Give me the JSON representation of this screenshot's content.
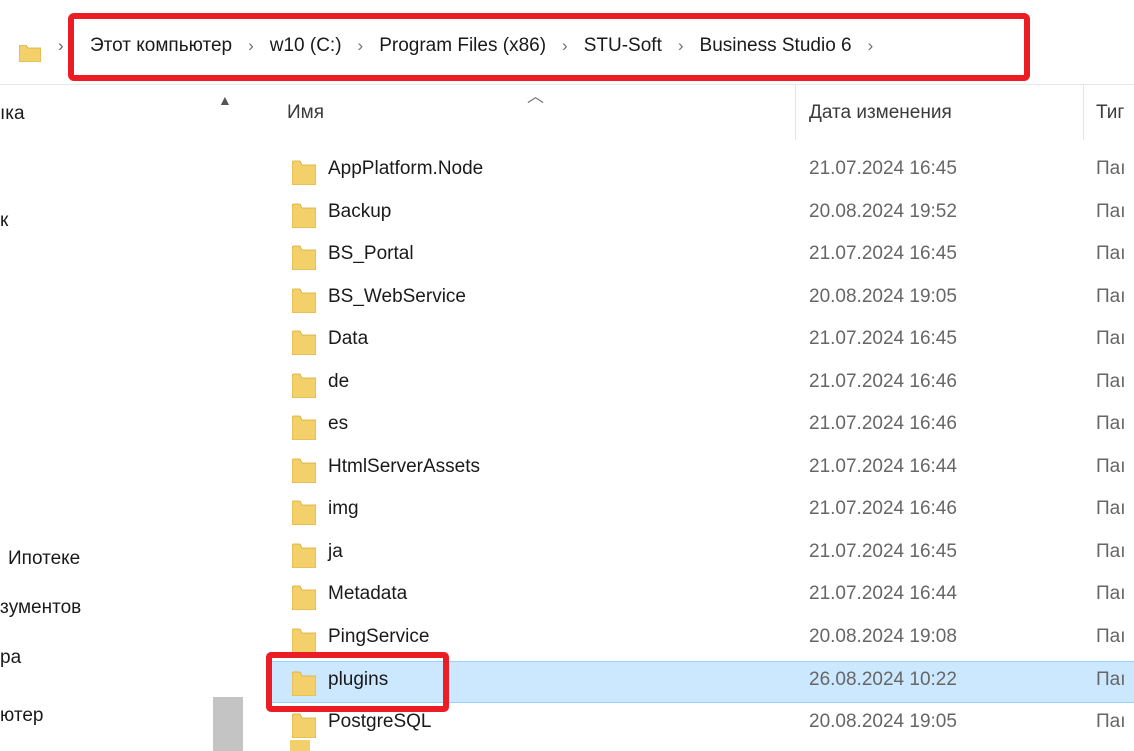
{
  "address_bar": {
    "crumbs": [
      "Этот компьютер",
      "w10 (C:)",
      "Program Files (x86)",
      "STU-Soft",
      "Business Studio 6"
    ],
    "separator": "›"
  },
  "nav_pane": {
    "items": [
      "ıка",
      "к",
      "Ипотеке",
      "ɜументов",
      "ра",
      "ютер"
    ]
  },
  "columns": {
    "name": "Имя",
    "date": "Дата изменения",
    "type": "Тиг"
  },
  "files": [
    {
      "name": "AppPlatform.Node",
      "date": "21.07.2024 16:45",
      "type": "Паı"
    },
    {
      "name": "Backup",
      "date": "20.08.2024 19:52",
      "type": "Паı"
    },
    {
      "name": "BS_Portal",
      "date": "21.07.2024 16:45",
      "type": "Паı"
    },
    {
      "name": "BS_WebService",
      "date": "20.08.2024 19:05",
      "type": "Паı"
    },
    {
      "name": "Data",
      "date": "21.07.2024 16:45",
      "type": "Паı"
    },
    {
      "name": "de",
      "date": "21.07.2024 16:46",
      "type": "Паı"
    },
    {
      "name": "es",
      "date": "21.07.2024 16:46",
      "type": "Паı"
    },
    {
      "name": "HtmlServerAssets",
      "date": "21.07.2024 16:44",
      "type": "Паı"
    },
    {
      "name": "img",
      "date": "21.07.2024 16:46",
      "type": "Паı"
    },
    {
      "name": "ja",
      "date": "21.07.2024 16:45",
      "type": "Паı"
    },
    {
      "name": "Metadata",
      "date": "21.07.2024 16:44",
      "type": "Паı"
    },
    {
      "name": "PingService",
      "date": "20.08.2024 19:08",
      "type": "Паı"
    },
    {
      "name": "plugins",
      "date": "26.08.2024 10:22",
      "type": "Паı"
    },
    {
      "name": "PostgreSQL",
      "date": "20.08.2024 19:05",
      "type": "Паı"
    }
  ],
  "selected_file": "plugins",
  "colors": {
    "annotation": "#ec1c24",
    "selection": "#cce8ff",
    "folder": "#f4d06b"
  }
}
